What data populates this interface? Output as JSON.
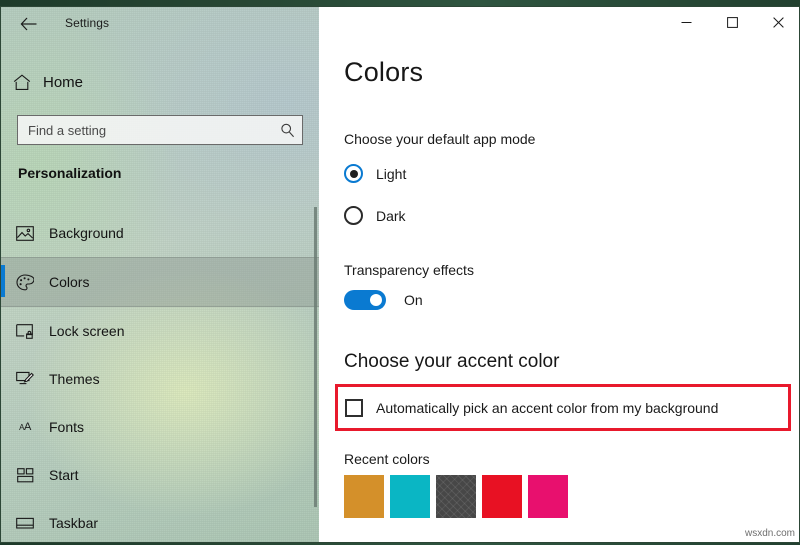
{
  "window": {
    "app_title": "Settings",
    "back_icon": "back-arrow-icon",
    "controls": {
      "minimize": "–",
      "maximize": "□",
      "close": "✕"
    }
  },
  "sidebar": {
    "home": {
      "label": "Home",
      "icon": "home-icon"
    },
    "search": {
      "placeholder": "Find a setting",
      "value": "",
      "icon": "search-icon"
    },
    "section_title": "Personalization",
    "items": [
      {
        "label": "Background",
        "icon": "picture-icon",
        "selected": false
      },
      {
        "label": "Colors",
        "icon": "palette-icon",
        "selected": true
      },
      {
        "label": "Lock screen",
        "icon": "lock-screen-icon",
        "selected": false
      },
      {
        "label": "Themes",
        "icon": "themes-brush-icon",
        "selected": false
      },
      {
        "label": "Fonts",
        "icon": "fonts-aa-icon",
        "selected": false
      },
      {
        "label": "Start",
        "icon": "start-tiles-icon",
        "selected": false
      },
      {
        "label": "Taskbar",
        "icon": "taskbar-icon",
        "selected": false
      }
    ],
    "accent_color": "#0a7ad1"
  },
  "main": {
    "page_title": "Colors",
    "app_mode": {
      "label": "Choose your default app mode",
      "options": [
        {
          "label": "Light",
          "selected": true
        },
        {
          "label": "Dark",
          "selected": false
        }
      ]
    },
    "transparency": {
      "label": "Transparency effects",
      "state": "On",
      "enabled": true
    },
    "accent": {
      "heading": "Choose your accent color",
      "auto_pick": {
        "label": "Automatically pick an accent color from my background",
        "checked": false,
        "highlight_color": "#e8192c"
      },
      "recent_label": "Recent colors",
      "recent_colors": [
        {
          "name": "gold",
          "hex": "#d4902a",
          "textured": false
        },
        {
          "name": "turquoise",
          "hex": "#0ab6c4",
          "textured": false
        },
        {
          "name": "dark-gray",
          "hex": "#474747",
          "textured": true
        },
        {
          "name": "red",
          "hex": "#e81123",
          "textured": false
        },
        {
          "name": "pink",
          "hex": "#e8106e",
          "textured": false
        }
      ]
    }
  },
  "watermark": "wsxdn.com"
}
